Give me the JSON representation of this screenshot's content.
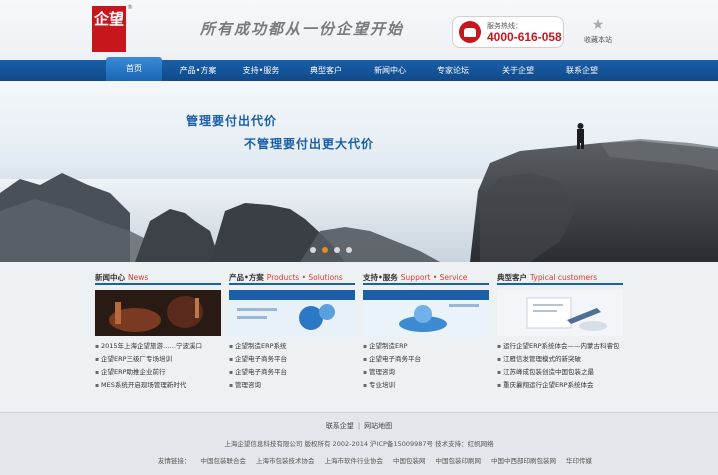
{
  "header": {
    "logo_text": "企望",
    "logo_mark": "®",
    "slogan": "所有成功都从一份企望开始",
    "hotline_label": "服务热线：",
    "hotline_number": "4000-616-058",
    "favorite_label": "收藏本站"
  },
  "nav": {
    "items": [
      {
        "label": "首页"
      },
      {
        "label": "产品•方案"
      },
      {
        "label": "支持•服务"
      },
      {
        "label": "典型客户"
      },
      {
        "label": "新闻中心"
      },
      {
        "label": "专家论坛"
      },
      {
        "label": "关于企望"
      },
      {
        "label": "联系企望"
      }
    ]
  },
  "banner": {
    "tagline1": "管理要付出代价",
    "tagline2": "不管理要付出更大代价",
    "active_slide": 2,
    "slide_count": 4
  },
  "columns": [
    {
      "title": "新闻中心",
      "title_en": "News",
      "items": [
        "2015年上海企望旅游……宁波溪口",
        "企望ERP三级厂专场培训",
        "企望ERP助推企业前行",
        "MES系统开启现场管理新时代"
      ]
    },
    {
      "title": "产品•方案",
      "title_en": "Products • Solutions",
      "items": [
        "企望制造ERP系统",
        "企望电子商务平台",
        "企望电子商务平台",
        "管理咨询"
      ]
    },
    {
      "title": "支持•服务",
      "title_en": "Support • Service",
      "items": [
        "企望制造ERP",
        "企望电子商务平台",
        "管理咨询",
        "专业培训"
      ]
    },
    {
      "title": "典型客户",
      "title_en": "Typical customers",
      "items": [
        "运行企望ERP系统体会——内蒙古科睿包",
        "江雁信发管理模式的新突破",
        "江苏峰成包装创造中国包装之最",
        "重庆曩翔运行企望ERP系统体会"
      ]
    }
  ],
  "footer": {
    "link1": "联系企望",
    "link2": "网站地图",
    "copyright": "上海企望信息科技有限公司 版权所有 2002-2014 沪ICP备15009987号 技术支持：红帆网络",
    "friends_label": "友情链接：",
    "friends": [
      "中国包装联合会",
      "上海市包装技术协会",
      "上海市软件行业协会",
      "中国包装网",
      "中国包装印刷网",
      "中国中西部印刷包装网",
      "华印传媒"
    ]
  }
}
